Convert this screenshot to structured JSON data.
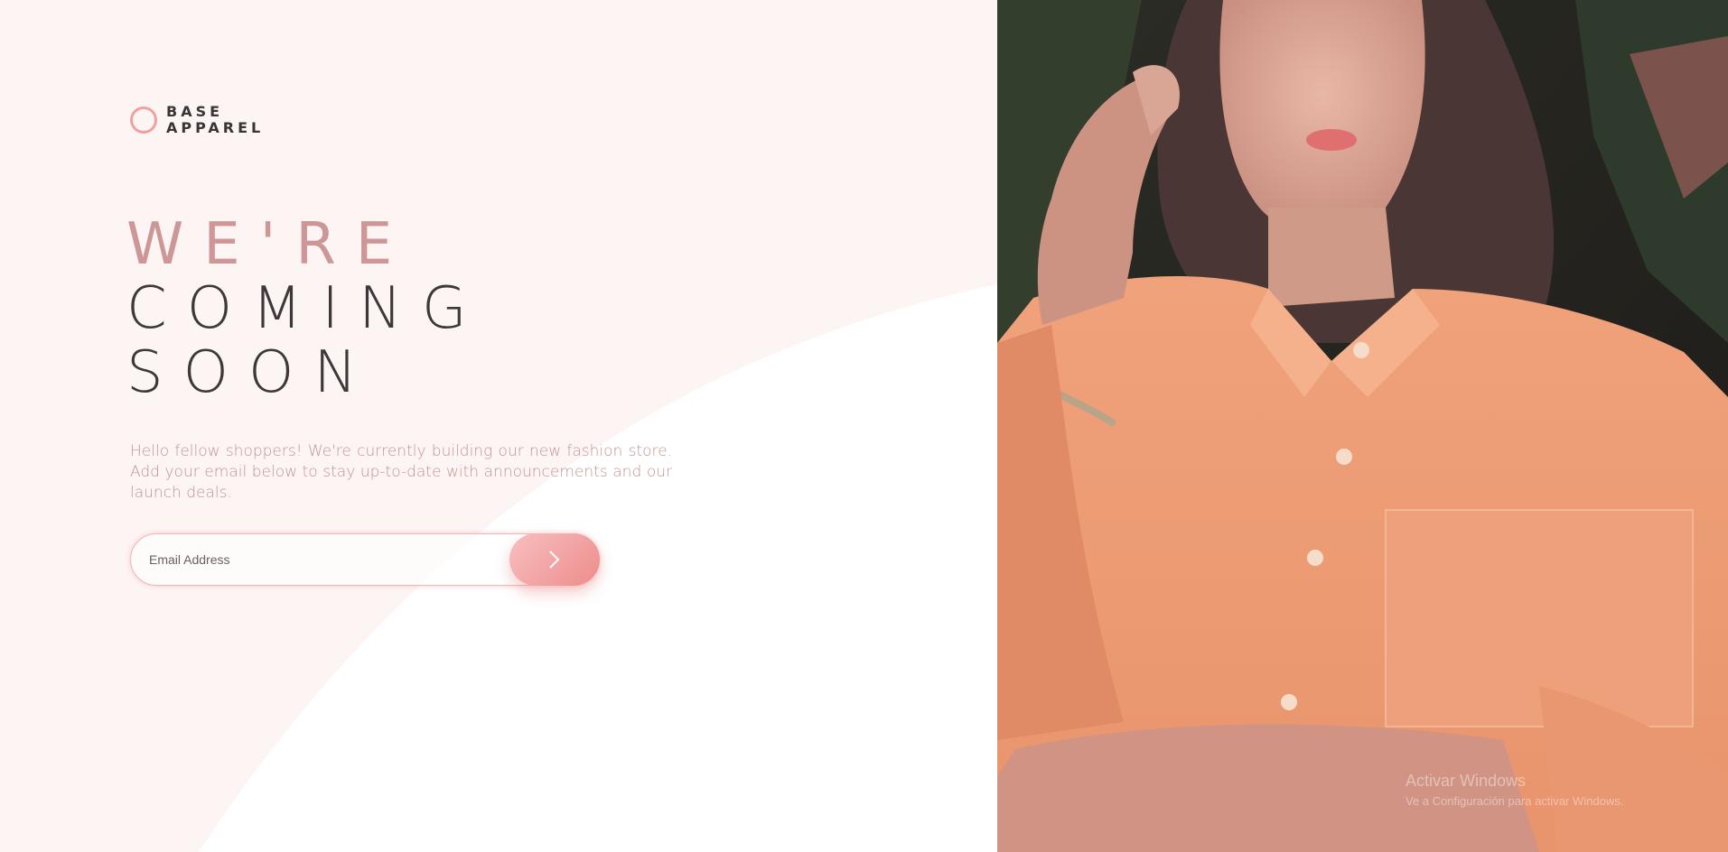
{
  "brand": {
    "line1": "BASE",
    "line2": "APPAREL"
  },
  "headline": {
    "line1": "WE'RE",
    "line2": "COMING",
    "line3": "SOON"
  },
  "description": "Hello fellow shoppers! We're currently building our new fashion store. Add your email below to stay up-to-date with announcements and our launch deals.",
  "form": {
    "email_placeholder": "Email Address",
    "email_value": "",
    "submit_icon": "chevron-right-icon"
  },
  "hero_image": {
    "alt": "hero-photo"
  },
  "windows_watermark": {
    "title": "Activar Windows",
    "subtitle": "Ve a Configuración para activar Windows."
  },
  "colors": {
    "accent": "#f0a0a0",
    "headline_pink": "#ce9797",
    "headline_dark": "#3e3838",
    "body_text": "#c39494",
    "background": "#fdf4f4"
  }
}
